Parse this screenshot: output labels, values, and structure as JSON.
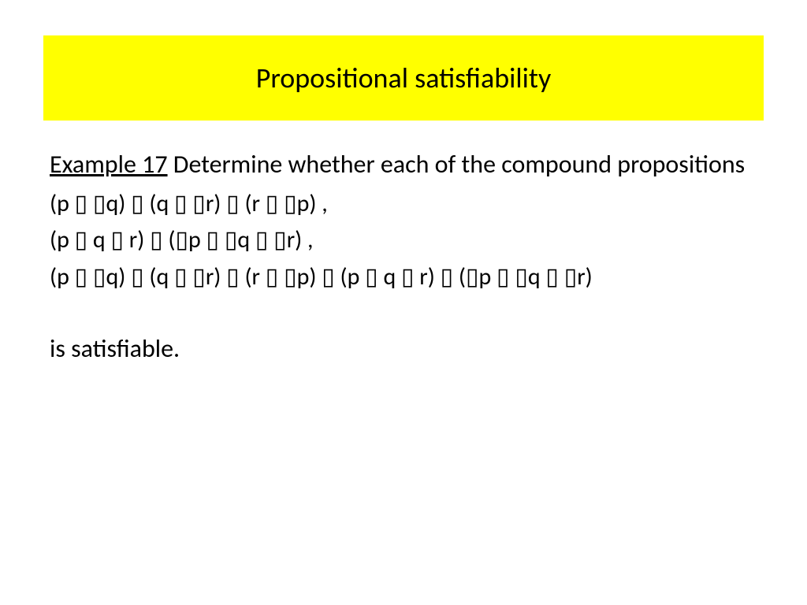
{
  "title": "Propositional satisfiability",
  "exampleLabel": "Example 17",
  "introRest": " Determine whether each of the compound propositions",
  "formulas": [
    "(p ▯ ▯q) ▯ (q ▯ ▯r) ▯ (r ▯ ▯p) ,",
    "(p ▯ q ▯ r) ▯ (▯p ▯ ▯q ▯ ▯r) ,",
    "(p ▯ ▯q) ▯ (q ▯ ▯r) ▯ (r ▯ ▯p) ▯ (p ▯ q ▯ r) ▯ (▯p ▯ ▯q ▯ ▯r)"
  ],
  "closing": "is satisfiable."
}
